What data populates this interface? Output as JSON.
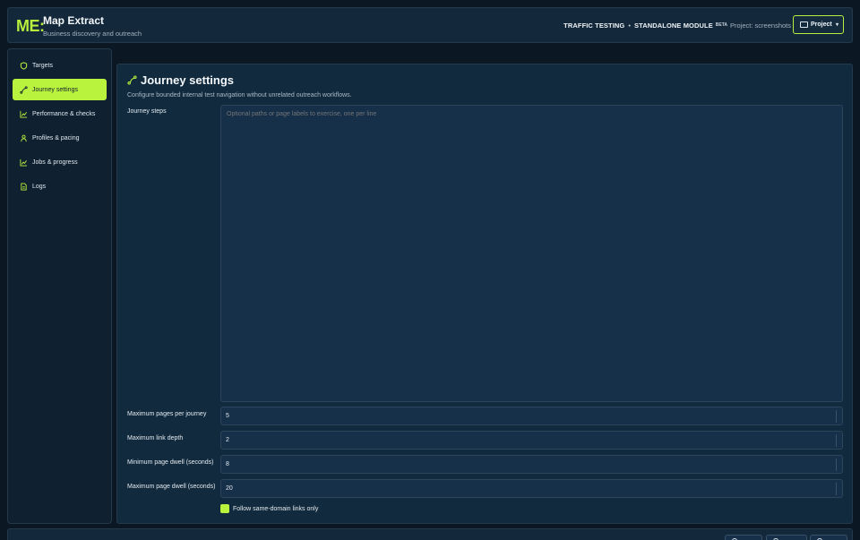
{
  "header": {
    "logo": "ME:",
    "title": "Map Extract",
    "subtitle": "Business discovery and outreach",
    "module_primary": "TRAFFIC TESTING",
    "separator": "•",
    "module_secondary": "STANDALONE MODULE",
    "beta": "BETA",
    "project_label": "Project: screenshots",
    "project_button": "Project"
  },
  "sidebar": {
    "items": [
      {
        "label": "Targets",
        "icon": "shield-icon",
        "active": false
      },
      {
        "label": "Journey settings",
        "icon": "route-icon",
        "active": true
      },
      {
        "label": "Performance & checks",
        "icon": "chart-icon",
        "active": false
      },
      {
        "label": "Profiles & pacing",
        "icon": "person-icon",
        "active": false
      },
      {
        "label": "Jobs & progress",
        "icon": "chart-icon",
        "active": false
      },
      {
        "label": "Logs",
        "icon": "file-icon",
        "active": false
      }
    ]
  },
  "main": {
    "title": "Journey settings",
    "description": "Configure bounded internal test navigation without unrelated outreach workflows.",
    "journey_steps_label": "Journey steps",
    "journey_steps_placeholder": "Optional paths or page labels to exercise, one per line",
    "fields": [
      {
        "label": "Maximum pages per journey",
        "value": "5"
      },
      {
        "label": "Maximum link depth",
        "value": "2"
      },
      {
        "label": "Minimum page dwell (seconds)",
        "value": "8"
      },
      {
        "label": "Maximum page dwell (seconds)",
        "value": "20"
      }
    ],
    "checkbox_label": "Follow same-domain links only",
    "checkbox_checked": true
  },
  "colors": {
    "accent": "#b9f33e",
    "background": "#0b1723",
    "panel": "#122a3d"
  }
}
